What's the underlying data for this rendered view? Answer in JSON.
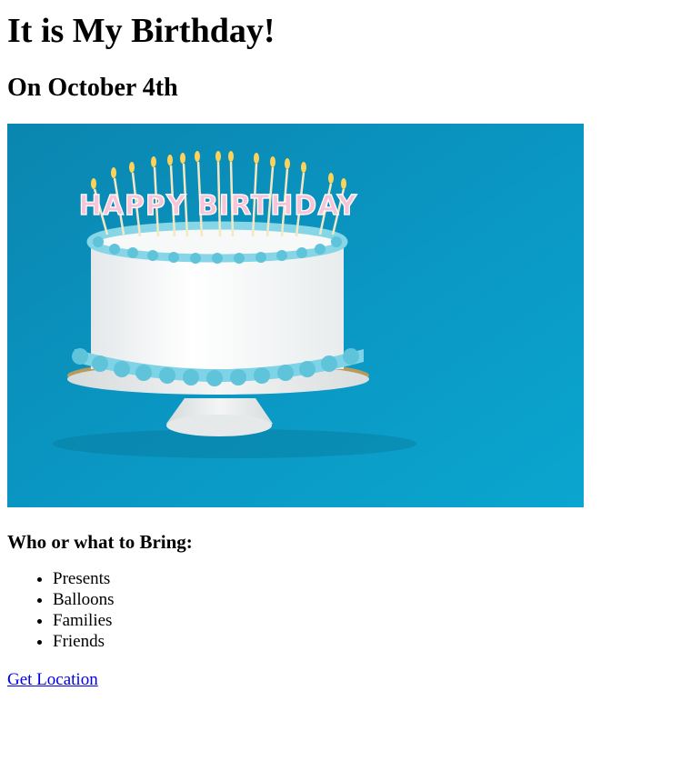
{
  "heading": "It is My Birthday!",
  "date_heading": "On October 4th",
  "hero_image": {
    "alt": "Birthday cake",
    "candles_text": "HAPPY BIRTHDAY",
    "colors": {
      "background": "#0a96c2",
      "frosting": "#f6f6f6",
      "trim": "#7fd3e6",
      "stand": "#e9eaea"
    }
  },
  "bring_heading": "Who or what to Bring:",
  "bring_list": [
    "Presents",
    "Balloons",
    "Families",
    "Friends"
  ],
  "location_link": "Get Location"
}
